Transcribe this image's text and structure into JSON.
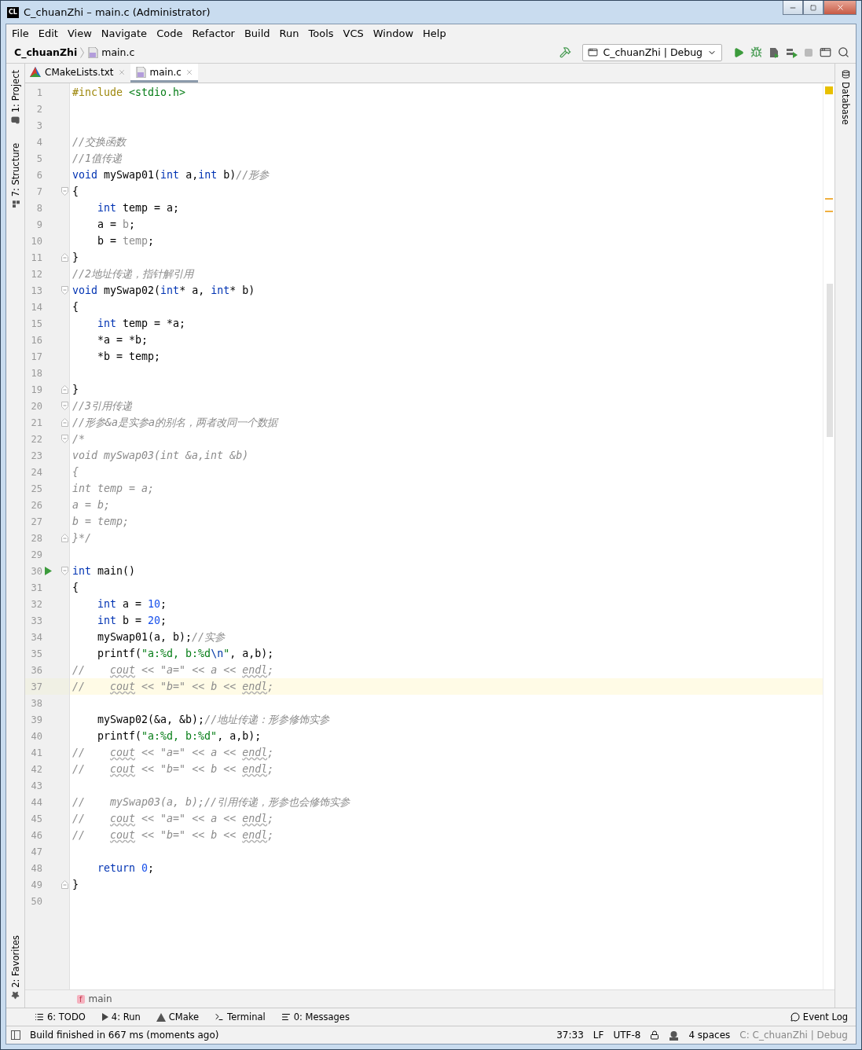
{
  "window": {
    "badge": "CL",
    "title": "C_chuanZhi – main.c (Administrator)"
  },
  "menu": [
    "File",
    "Edit",
    "View",
    "Navigate",
    "Code",
    "Refactor",
    "Build",
    "Run",
    "Tools",
    "VCS",
    "Window",
    "Help"
  ],
  "navbar": {
    "project": "C_chuanZhi",
    "file": "main.c",
    "run_config": "C_chuanZhi | Debug"
  },
  "left_tool_windows": [
    {
      "label": "1: Project",
      "kind": "folder"
    },
    {
      "label": "7: Structure",
      "kind": "structure"
    }
  ],
  "left_bottom_tool_windows": [
    {
      "label": "2: Favorites",
      "kind": "star"
    }
  ],
  "right_tool_windows": [
    {
      "label": "Database"
    }
  ],
  "tabs": [
    {
      "label": "CMakeLists.txt",
      "kind": "cmake",
      "selected": false
    },
    {
      "label": "main.c",
      "kind": "c",
      "selected": true
    }
  ],
  "editor": {
    "lines": [
      {
        "number": "1",
        "tokens": [
          {
            "kind": "pre",
            "text": "#include"
          },
          {
            "kind": "str",
            "text": " <stdio.h>"
          }
        ]
      },
      {
        "number": "2"
      },
      {
        "number": "3"
      },
      {
        "number": "4",
        "tokens": [
          {
            "kind": "com",
            "text": "//交换函数"
          }
        ]
      },
      {
        "number": "5",
        "tokens": [
          {
            "kind": "com",
            "text": "//1值传递"
          }
        ]
      },
      {
        "number": "6",
        "tokens": [
          {
            "kind": "kw",
            "text": "void"
          },
          {
            "kind": "id",
            "text": " mySwap01("
          },
          {
            "kind": "kw",
            "text": "int"
          },
          {
            "kind": "id",
            "text": " a,"
          },
          {
            "kind": "kw",
            "text": "int"
          },
          {
            "kind": "id",
            "text": " b)"
          },
          {
            "kind": "com",
            "text": "//形参"
          }
        ]
      },
      {
        "number": "7",
        "fold_start": true,
        "tokens": [
          {
            "kind": "id",
            "text": "{"
          }
        ]
      },
      {
        "number": "8",
        "tokens": [
          {
            "kind": "kw",
            "text": "    int"
          },
          {
            "kind": "id",
            "text": " temp = a;"
          }
        ]
      },
      {
        "number": "9",
        "tokens": [
          {
            "kind": "id",
            "text": "    a = "
          },
          {
            "kind": "dim",
            "text": "b"
          },
          {
            "kind": "id",
            "text": ";"
          }
        ]
      },
      {
        "number": "10",
        "tokens": [
          {
            "kind": "id",
            "text": "    b = "
          },
          {
            "kind": "dim",
            "text": "temp"
          },
          {
            "kind": "id",
            "text": ";"
          }
        ]
      },
      {
        "number": "11",
        "fold_end": true,
        "tokens": [
          {
            "kind": "id",
            "text": "}"
          }
        ]
      },
      {
        "number": "12",
        "tokens": [
          {
            "kind": "com",
            "text": "//2地址传递，指针解引用"
          }
        ]
      },
      {
        "number": "13",
        "fold_start": true,
        "tokens": [
          {
            "kind": "kw",
            "text": "void"
          },
          {
            "kind": "id",
            "text": " mySwap02("
          },
          {
            "kind": "kw",
            "text": "int"
          },
          {
            "kind": "id",
            "text": "* a, "
          },
          {
            "kind": "kw",
            "text": "int"
          },
          {
            "kind": "id",
            "text": "* b)"
          }
        ]
      },
      {
        "number": "14",
        "tokens": [
          {
            "kind": "id",
            "text": "{"
          }
        ]
      },
      {
        "number": "15",
        "tokens": [
          {
            "kind": "kw",
            "text": "    int"
          },
          {
            "kind": "id",
            "text": " temp = *a;"
          }
        ]
      },
      {
        "number": "16",
        "tokens": [
          {
            "kind": "id",
            "text": "    *a = *b;"
          }
        ]
      },
      {
        "number": "17",
        "tokens": [
          {
            "kind": "id",
            "text": "    *b = temp;"
          }
        ]
      },
      {
        "number": "18"
      },
      {
        "number": "19",
        "fold_end": true,
        "tokens": [
          {
            "kind": "id",
            "text": "}"
          }
        ]
      },
      {
        "number": "20",
        "fold_start": true,
        "tokens": [
          {
            "kind": "com",
            "text": "//3引用传递"
          }
        ]
      },
      {
        "number": "21",
        "fold_end": true,
        "tokens": [
          {
            "kind": "com",
            "text": "//形参&a是实参a的别名，两者改同一个数据"
          }
        ]
      },
      {
        "number": "22",
        "fold_start": true,
        "tokens": [
          {
            "kind": "off",
            "text": "/*"
          }
        ]
      },
      {
        "number": "23",
        "tokens": [
          {
            "kind": "off",
            "text": "void mySwap03(int &a,int &b)"
          }
        ]
      },
      {
        "number": "24",
        "tokens": [
          {
            "kind": "off",
            "text": "{"
          }
        ]
      },
      {
        "number": "25",
        "tokens": [
          {
            "kind": "off",
            "text": "int temp = a;"
          }
        ]
      },
      {
        "number": "26",
        "tokens": [
          {
            "kind": "off",
            "text": "a = b;"
          }
        ]
      },
      {
        "number": "27",
        "tokens": [
          {
            "kind": "off",
            "text": "b = temp;"
          }
        ]
      },
      {
        "number": "28",
        "fold_end": true,
        "tokens": [
          {
            "kind": "off",
            "text": "}*/"
          }
        ]
      },
      {
        "number": "29"
      },
      {
        "number": "30",
        "fold_start": true,
        "run": true,
        "tokens": [
          {
            "kind": "kw",
            "text": "int"
          },
          {
            "kind": "id",
            "text": " main()"
          }
        ]
      },
      {
        "number": "31",
        "tokens": [
          {
            "kind": "id",
            "text": "{"
          }
        ]
      },
      {
        "number": "32",
        "tokens": [
          {
            "kind": "kw",
            "text": "    int"
          },
          {
            "kind": "id",
            "text": " a = "
          },
          {
            "kind": "num",
            "text": "10"
          },
          {
            "kind": "id",
            "text": ";"
          }
        ]
      },
      {
        "number": "33",
        "tokens": [
          {
            "kind": "kw",
            "text": "    int"
          },
          {
            "kind": "id",
            "text": " b = "
          },
          {
            "kind": "num",
            "text": "20"
          },
          {
            "kind": "id",
            "text": ";"
          }
        ]
      },
      {
        "number": "34",
        "tokens": [
          {
            "kind": "id",
            "text": "    mySwap01(a, b);"
          },
          {
            "kind": "com",
            "text": "//实参"
          }
        ]
      },
      {
        "number": "35",
        "tokens": [
          {
            "kind": "id",
            "text": "    printf("
          },
          {
            "kind": "str",
            "text": "\"a:%d, b:%d"
          },
          {
            "kind": "esc",
            "text": "\\n"
          },
          {
            "kind": "str",
            "text": "\""
          },
          {
            "kind": "id",
            "text": ", a,b);"
          }
        ]
      },
      {
        "number": "36",
        "tokens": [
          {
            "kind": "off",
            "text": "//    "
          },
          {
            "kind": "wavy",
            "text": "cout"
          },
          {
            "kind": "off",
            "text": " << \"a=\" << a << "
          },
          {
            "kind": "wavy",
            "text": "endl"
          },
          {
            "kind": "off",
            "text": ";"
          }
        ]
      },
      {
        "number": "37",
        "current": true,
        "tokens": [
          {
            "kind": "off",
            "text": "//    "
          },
          {
            "kind": "wavy",
            "text": "cout"
          },
          {
            "kind": "off",
            "text": " << \"b=\" << b << "
          },
          {
            "kind": "wavy",
            "text": "endl"
          },
          {
            "kind": "off",
            "text": ";"
          }
        ]
      },
      {
        "number": "38"
      },
      {
        "number": "39",
        "tokens": [
          {
            "kind": "id",
            "text": "    mySwap02(&a, &b);"
          },
          {
            "kind": "com",
            "text": "//地址传递：形参修饰实参"
          }
        ]
      },
      {
        "number": "40",
        "tokens": [
          {
            "kind": "id",
            "text": "    printf("
          },
          {
            "kind": "str",
            "text": "\"a:%d, b:%d\""
          },
          {
            "kind": "id",
            "text": ", a,b);"
          }
        ]
      },
      {
        "number": "41",
        "tokens": [
          {
            "kind": "off",
            "text": "//    "
          },
          {
            "kind": "wavy",
            "text": "cout"
          },
          {
            "kind": "off",
            "text": " << \"a=\" << a << "
          },
          {
            "kind": "wavy",
            "text": "endl"
          },
          {
            "kind": "off",
            "text": ";"
          }
        ]
      },
      {
        "number": "42",
        "tokens": [
          {
            "kind": "off",
            "text": "//    "
          },
          {
            "kind": "wavy",
            "text": "cout"
          },
          {
            "kind": "off",
            "text": " << \"b=\" << b << "
          },
          {
            "kind": "wavy",
            "text": "endl"
          },
          {
            "kind": "off",
            "text": ";"
          }
        ]
      },
      {
        "number": "43"
      },
      {
        "number": "44",
        "tokens": [
          {
            "kind": "off",
            "text": "//    mySwap03(a, b);//引用传递，形参也会修饰实参"
          }
        ]
      },
      {
        "number": "45",
        "tokens": [
          {
            "kind": "off",
            "text": "//    "
          },
          {
            "kind": "wavy",
            "text": "cout"
          },
          {
            "kind": "off",
            "text": " << \"a=\" << a << "
          },
          {
            "kind": "wavy",
            "text": "endl"
          },
          {
            "kind": "off",
            "text": ";"
          }
        ]
      },
      {
        "number": "46",
        "tokens": [
          {
            "kind": "off",
            "text": "//    "
          },
          {
            "kind": "wavy",
            "text": "cout"
          },
          {
            "kind": "off",
            "text": " << \"b=\" << b << "
          },
          {
            "kind": "wavy",
            "text": "endl"
          },
          {
            "kind": "off",
            "text": ";"
          }
        ]
      },
      {
        "number": "47"
      },
      {
        "number": "48",
        "tokens": [
          {
            "kind": "kw",
            "text": "    return"
          },
          {
            "kind": "num",
            "text": " 0"
          },
          {
            "kind": "id",
            "text": ";"
          }
        ]
      },
      {
        "number": "49",
        "fold_end": true,
        "tokens": [
          {
            "kind": "id",
            "text": "}"
          }
        ]
      },
      {
        "number": "50"
      }
    ]
  },
  "breadcrumb": {
    "badge": "f",
    "label": "main"
  },
  "tool_windows": [
    {
      "label": "6: TODO",
      "kind": "todo"
    },
    {
      "label": "4: Run",
      "kind": "run"
    },
    {
      "label": "CMake",
      "kind": "cmake"
    },
    {
      "label": "Terminal",
      "kind": "terminal"
    },
    {
      "label": "0: Messages",
      "kind": "messages"
    }
  ],
  "event_log": "Event Log",
  "status": {
    "message": "Build finished in 667 ms (moments ago)",
    "position": "37:33",
    "line_separator": "LF",
    "encoding": "UTF-8",
    "indent": "4 spaces",
    "context": "C: C_chuanZhi | Debug"
  }
}
